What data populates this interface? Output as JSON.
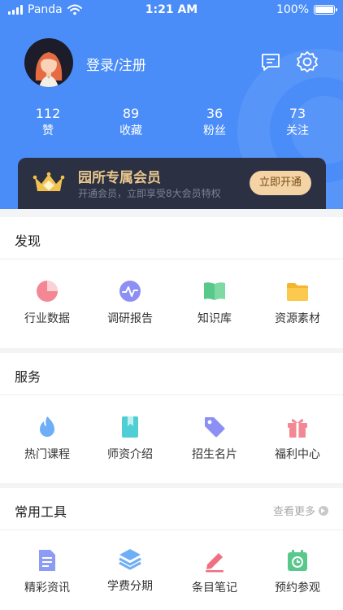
{
  "status_bar": {
    "carrier": "Panda",
    "time": "1:21 AM",
    "battery": "100%",
    "battery_level": 1.0
  },
  "profile": {
    "login_label": "登录/注册"
  },
  "stats": [
    {
      "value": "112",
      "label": "赞"
    },
    {
      "value": "89",
      "label": "收藏"
    },
    {
      "value": "36",
      "label": "粉丝"
    },
    {
      "value": "73",
      "label": "关注"
    }
  ],
  "vip": {
    "title": "园所专属会员",
    "description": "开通会员，立即享受8大会员特权",
    "button": "立即开通"
  },
  "discover": {
    "title": "发现",
    "items": [
      {
        "label": "行业数据",
        "icon": "pie-chart-icon"
      },
      {
        "label": "调研报告",
        "icon": "pulse-icon"
      },
      {
        "label": "知识库",
        "icon": "book-icon"
      },
      {
        "label": "资源素材",
        "icon": "folder-icon"
      }
    ]
  },
  "services": {
    "title": "服务",
    "items": [
      {
        "label": "热门课程",
        "icon": "flame-icon"
      },
      {
        "label": "师资介绍",
        "icon": "bookmark-icon"
      },
      {
        "label": "招生名片",
        "icon": "tag-icon"
      },
      {
        "label": "福利中心",
        "icon": "gift-icon"
      }
    ]
  },
  "tools": {
    "title": "常用工具",
    "more": "查看更多",
    "items": [
      {
        "label": "精彩资讯",
        "icon": "document-icon"
      },
      {
        "label": "学费分期",
        "icon": "layers-icon"
      },
      {
        "label": "条目笔记",
        "icon": "pencil-icon"
      },
      {
        "label": "预约参观",
        "icon": "calendar-clock-icon"
      }
    ]
  },
  "colors": {
    "primary": "#4a8df8",
    "vip_bg": "#2b3142",
    "vip_gold": "#e7c58c",
    "vip_button": "#f4d3a4"
  }
}
